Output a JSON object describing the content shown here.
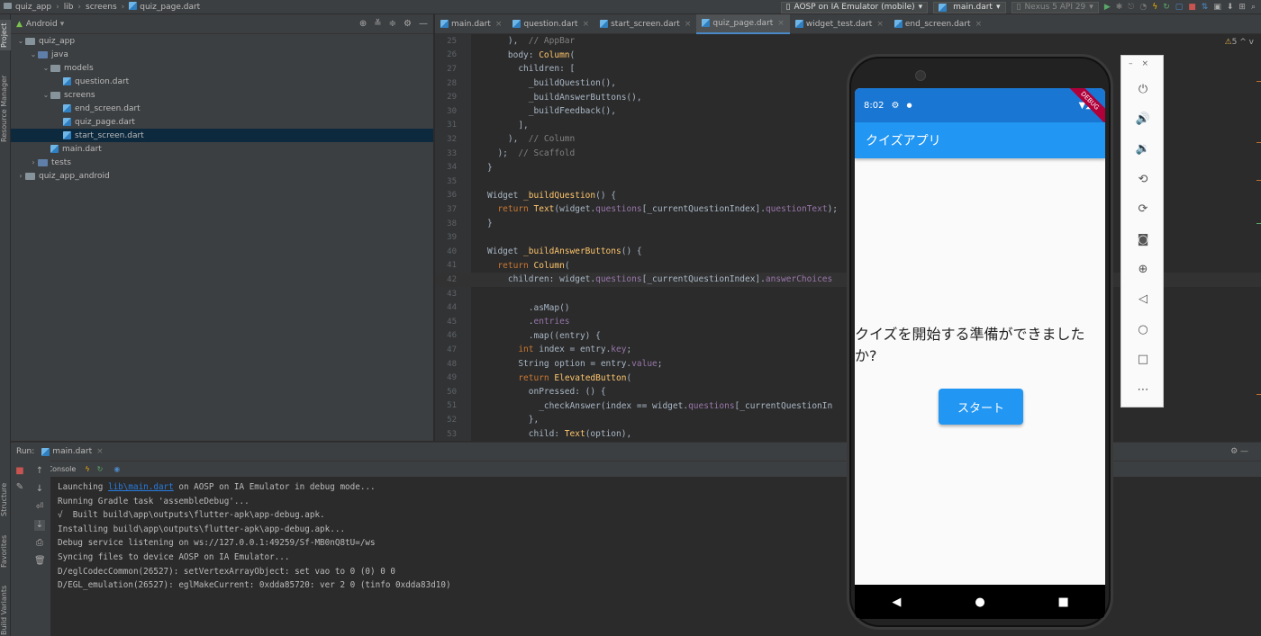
{
  "breadcrumb": [
    "quiz_app",
    "lib",
    "screens",
    "quiz_page.dart"
  ],
  "toolbar": {
    "device_combo": "AOSP on IA Emulator (mobile)",
    "config_combo": "main.dart",
    "avd_combo": "Nexus 5 API 29"
  },
  "left_strip": {
    "project": "Project",
    "resource_manager": "Resource Manager",
    "structure": "Structure",
    "favorites": "Favorites",
    "build_variants": "Build Variants"
  },
  "project_panel": {
    "view_selector": "Android",
    "tree": [
      {
        "label": "quiz_app",
        "indent": 0,
        "chevron": "v",
        "type": "module"
      },
      {
        "label": "java",
        "indent": 1,
        "chevron": "v",
        "type": "src"
      },
      {
        "label": "models",
        "indent": 2,
        "chevron": "v",
        "type": "folder"
      },
      {
        "label": "question.dart",
        "indent": 3,
        "chevron": "",
        "type": "dart"
      },
      {
        "label": "screens",
        "indent": 2,
        "chevron": "v",
        "type": "folder"
      },
      {
        "label": "end_screen.dart",
        "indent": 3,
        "chevron": "",
        "type": "dart"
      },
      {
        "label": "quiz_page.dart",
        "indent": 3,
        "chevron": "",
        "type": "dart"
      },
      {
        "label": "start_screen.dart",
        "indent": 3,
        "chevron": "",
        "type": "dart",
        "selected": true
      },
      {
        "label": "main.dart",
        "indent": 2,
        "chevron": "",
        "type": "dart"
      },
      {
        "label": "tests",
        "indent": 1,
        "chevron": ">",
        "type": "src"
      },
      {
        "label": "quiz_app_android",
        "indent": 0,
        "chevron": ">",
        "type": "module"
      }
    ]
  },
  "editor_tabs": [
    {
      "label": "main.dart",
      "active": false
    },
    {
      "label": "question.dart",
      "active": false
    },
    {
      "label": "start_screen.dart",
      "active": false
    },
    {
      "label": "quiz_page.dart",
      "active": true
    },
    {
      "label": "widget_test.dart",
      "active": false
    },
    {
      "label": "end_screen.dart",
      "active": false
    }
  ],
  "editor": {
    "inspection_badge": "5",
    "current_line": 42,
    "lines": [
      {
        "n": 25,
        "html": "    ),  <span class='cm'>// AppBar</span>"
      },
      {
        "n": 26,
        "html": "    body: <span class='fn'>Column</span>("
      },
      {
        "n": 27,
        "html": "      children: ["
      },
      {
        "n": 28,
        "html": "        _buildQuestion(),"
      },
      {
        "n": 29,
        "html": "        _buildAnswerButtons(),"
      },
      {
        "n": 30,
        "html": "        _buildFeedback(),"
      },
      {
        "n": 31,
        "html": "      ],"
      },
      {
        "n": 32,
        "html": "    ),  <span class='cm'>// Column</span>"
      },
      {
        "n": 33,
        "html": "  );  <span class='cm'>// Scaffold</span>"
      },
      {
        "n": 34,
        "html": "}"
      },
      {
        "n": 35,
        "html": ""
      },
      {
        "n": 36,
        "html": "Widget <span class='fn'>_buildQuestion</span>() {"
      },
      {
        "n": 37,
        "html": "  <span class='kw'>return</span> <span class='fn'>Text</span>(widget.<span class='field'>questions</span>[_currentQuestionIndex].<span class='field'>questionText</span>);"
      },
      {
        "n": 38,
        "html": "}"
      },
      {
        "n": 39,
        "html": ""
      },
      {
        "n": 40,
        "html": "Widget <span class='fn'>_buildAnswerButtons</span>() {"
      },
      {
        "n": 41,
        "html": "  <span class='kw'>return</span> <span class='fn'>Column</span>("
      },
      {
        "n": 42,
        "html": "    children: widget.<span class='field'>questions</span>[_currentQuestionIndex].<span class='field'>answerChoices</span>"
      },
      {
        "n": 43,
        "html": ""
      },
      {
        "n": 44,
        "html": "        .asMap()"
      },
      {
        "n": 45,
        "html": "        .<span class='field'>entries</span>"
      },
      {
        "n": 46,
        "html": "        .map((entry) {"
      },
      {
        "n": 47,
        "html": "      <span class='kw'>int</span> index = entry.<span class='field'>key</span>;"
      },
      {
        "n": 48,
        "html": "      String option = entry.<span class='field'>value</span>;"
      },
      {
        "n": 49,
        "html": "      <span class='kw'>return</span> <span class='fn'>ElevatedButton</span>("
      },
      {
        "n": 50,
        "html": "        onPressed: () {"
      },
      {
        "n": 51,
        "html": "          _checkAnswer(index == widget.<span class='field'>questions</span>[_currentQuestionIn"
      },
      {
        "n": 52,
        "html": "        },"
      },
      {
        "n": 53,
        "html": "        child: <span class='fn'>Text</span>(option),"
      }
    ]
  },
  "run_panel": {
    "label": "Run:",
    "config": "main.dart",
    "console_tab": "Console",
    "output": [
      {
        "pre": "Launching ",
        "link": "lib\\main.dart",
        "post": " on AOSP on IA Emulator in debug mode..."
      },
      {
        "pre": "Running Gradle task 'assembleDebug'...",
        "link": "",
        "post": ""
      },
      {
        "pre": "√  Built build\\app\\outputs\\flutter-apk\\app-debug.apk.",
        "link": "",
        "post": ""
      },
      {
        "pre": "Installing build\\app\\outputs\\flutter-apk\\app-debug.apk...",
        "link": "",
        "post": ""
      },
      {
        "pre": "Debug service listening on ws://127.0.0.1:49259/Sf-MB0nQ8tU=/ws",
        "link": "",
        "post": ""
      },
      {
        "pre": "Syncing files to device AOSP on IA Emulator...",
        "link": "",
        "post": ""
      },
      {
        "pre": "D/eglCodecCommon(26527): setVertexArrayObject: set vao to 0 (0) 0 0",
        "link": "",
        "post": ""
      },
      {
        "pre": "D/EGL_emulation(26527): eglMakeCurrent: 0xdda85720: ver 2 0 (tinfo 0xdda83d10)",
        "link": "",
        "post": ""
      }
    ]
  },
  "device": {
    "status_time": "8:02",
    "debug_banner": "DEBUG",
    "appbar_title": "クイズアプリ",
    "prompt": "クイズを開始する準備ができましたか?",
    "start_button": "スタート"
  },
  "colors": {
    "ide_bg": "#2b2b2b",
    "ide_panel": "#3c3f41",
    "app_primary": "#2196f3",
    "status_bar": "#1976d2"
  }
}
